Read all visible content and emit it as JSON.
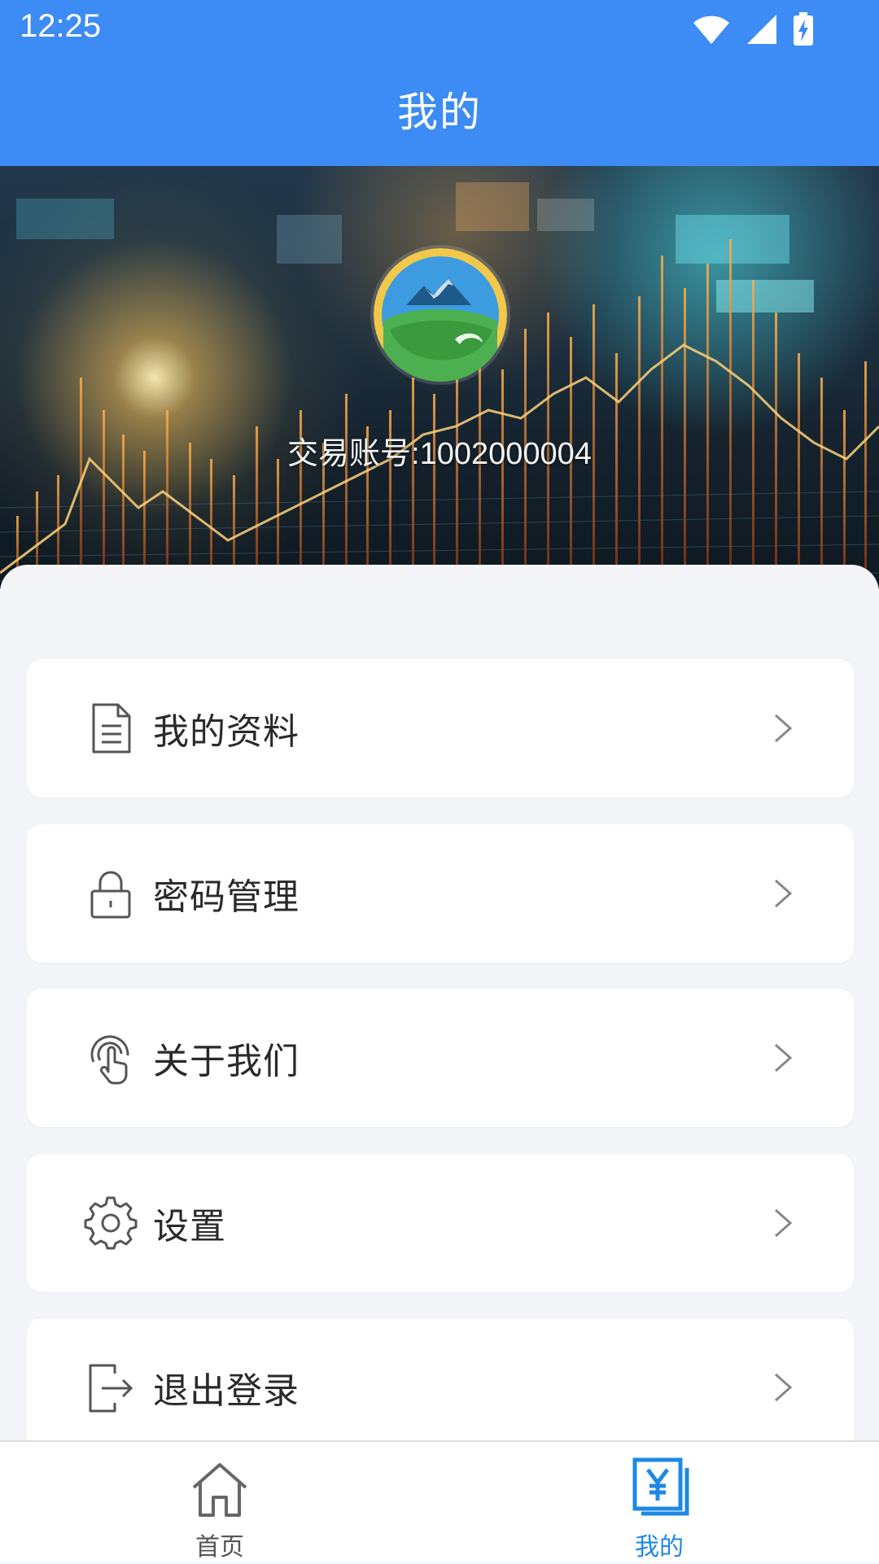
{
  "status_bar": {
    "time": "12:25",
    "icons": [
      "wifi-icon",
      "cellular-signal-icon",
      "battery-charging-icon"
    ]
  },
  "header": {
    "title": "我的"
  },
  "profile": {
    "avatar": "mountain-logo",
    "account_text": "交易账号:1002000004"
  },
  "menu": {
    "items": [
      {
        "label": "我的资料",
        "icon": "document-icon"
      },
      {
        "label": "密码管理",
        "icon": "lock-icon"
      },
      {
        "label": "关于我们",
        "icon": "touch-icon"
      },
      {
        "label": "设置",
        "icon": "gear-icon"
      },
      {
        "label": "退出登录",
        "icon": "logout-icon"
      }
    ]
  },
  "bottom_nav": {
    "tabs": [
      {
        "label": "首页",
        "icon": "home-icon",
        "active": false
      },
      {
        "label": "我的",
        "icon": "yuan-card-icon",
        "active": true
      }
    ]
  },
  "colors": {
    "primary": "#3d8bf5",
    "nav_active": "#1e88e5",
    "nav_inactive": "#555555",
    "background": "#f3f5f9"
  }
}
